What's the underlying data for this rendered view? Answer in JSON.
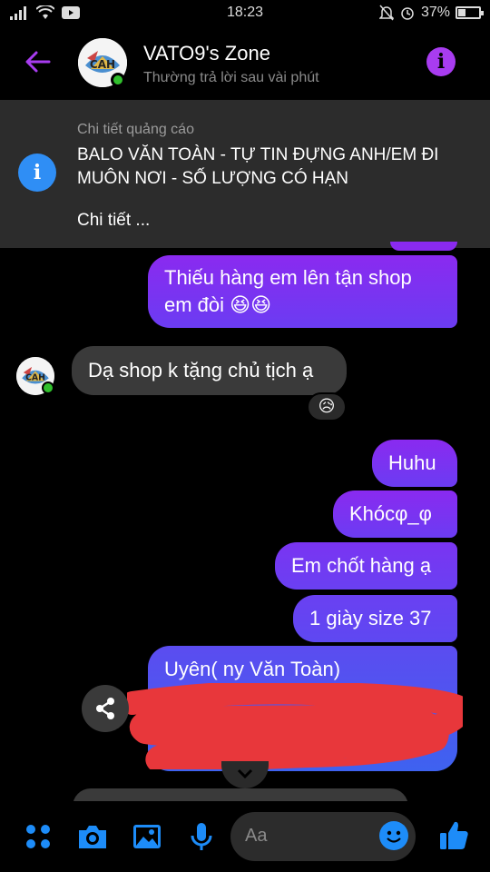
{
  "status_bar": {
    "time": "18:23",
    "battery_percent": 37,
    "battery_label": "37%"
  },
  "header": {
    "title": "VATO9's Zone",
    "subtitle": "Thường trả lời sau vài phút",
    "icons": [
      "back-arrow-icon",
      "avatar",
      "info-icon"
    ]
  },
  "ad": {
    "label": "Chi tiết quảng cáo",
    "text": "BALO VĂN TOÀN - TỰ TIN ĐỰNG ANH/EM ĐI MUÔN NƠI - SỐ LƯỢNG CÓ HẠN",
    "link": "Chi tiết ..."
  },
  "messages": [
    {
      "from": "me",
      "text": "Thiếu hàng em lên tận shop em đòi 😆😆"
    },
    {
      "from": "page",
      "text": "Dạ shop k tặng chủ tịch ạ",
      "reaction": "😥"
    },
    {
      "from": "me",
      "text": "Huhu"
    },
    {
      "from": "me",
      "text": "Khócφ_φ"
    },
    {
      "from": "me",
      "text": "Em chốt hàng ạ"
    },
    {
      "from": "me",
      "text": "1 giày size 37"
    },
    {
      "from": "me",
      "text": "Uyên( ny Văn Toàn)"
    }
  ],
  "composer": {
    "placeholder": "Aa",
    "icons": [
      "apps-icon",
      "camera-icon",
      "gallery-icon",
      "microphone-icon",
      "emoji-icon",
      "thumbs-up-icon"
    ]
  },
  "colors": {
    "accent": "#a83cf0",
    "outgoing_top": "#8a2af0",
    "outgoing_bottom": "#5b4cf0",
    "incoming": "#3a3a3a",
    "composer_icons": "#1d8cf8",
    "redaction": "#e8373b"
  }
}
